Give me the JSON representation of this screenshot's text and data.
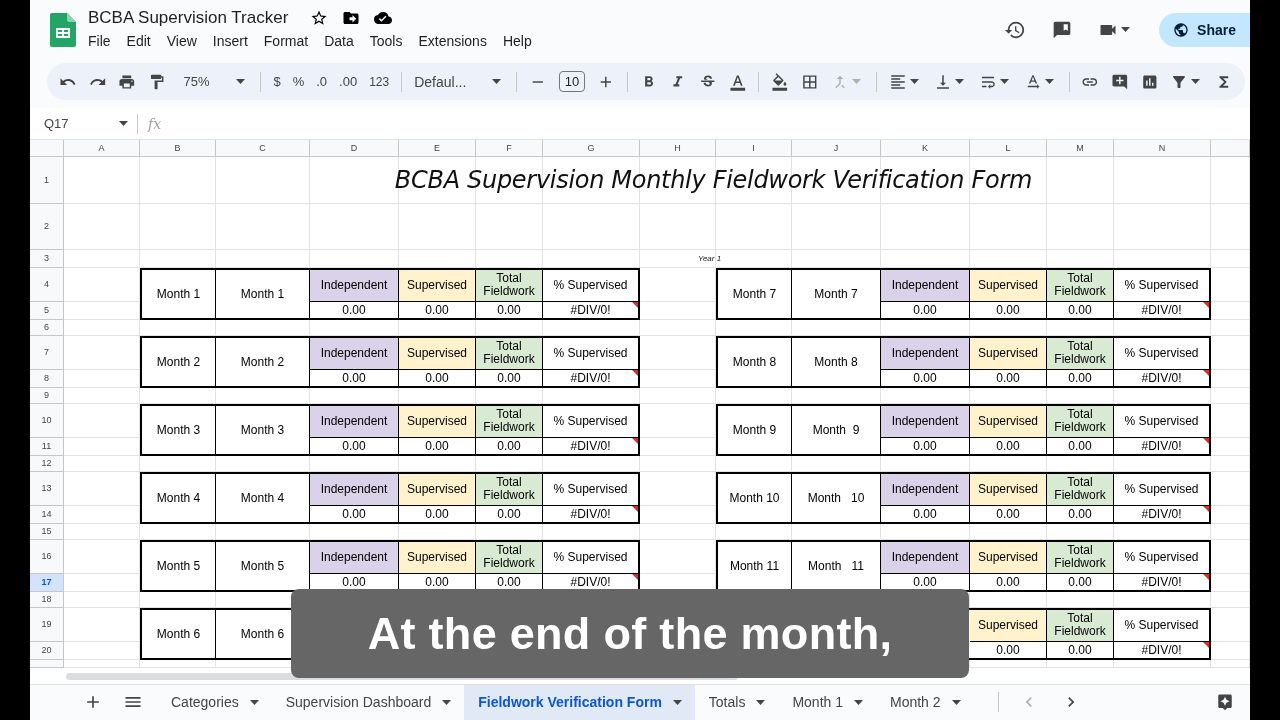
{
  "document": {
    "title": "BCBA Supervision Tracker"
  },
  "menu": [
    "File",
    "Edit",
    "View",
    "Insert",
    "Format",
    "Data",
    "Tools",
    "Extensions",
    "Help"
  ],
  "share": "Share",
  "toolbar": {
    "zoom": "75%",
    "format_items": [
      "$",
      "%",
      ".0",
      ".00",
      "123"
    ],
    "font": "Defaul...",
    "font_size": "10"
  },
  "formula_bar": {
    "cell_ref": "Q17",
    "fx": "fx"
  },
  "columns": [
    "A",
    "B",
    "C",
    "D",
    "E",
    "F",
    "G",
    "H",
    "I",
    "J",
    "K",
    "L",
    "M",
    "N"
  ],
  "rows": [
    {
      "label": "1",
      "selected": false
    },
    {
      "label": "2",
      "selected": false
    },
    {
      "label": "3",
      "selected": false
    },
    {
      "label": "4",
      "selected": false
    },
    {
      "label": "5",
      "selected": false
    },
    {
      "label": "6",
      "selected": false
    },
    {
      "label": "7",
      "selected": false
    },
    {
      "label": "8",
      "selected": false
    },
    {
      "label": "9",
      "selected": false
    },
    {
      "label": "10",
      "selected": false
    },
    {
      "label": "11",
      "selected": false
    },
    {
      "label": "12",
      "selected": false
    },
    {
      "label": "13",
      "selected": false
    },
    {
      "label": "14",
      "selected": false
    },
    {
      "label": "15",
      "selected": false
    },
    {
      "label": "16",
      "selected": false
    },
    {
      "label": "17",
      "selected": true
    },
    {
      "label": "18",
      "selected": false
    },
    {
      "label": "19",
      "selected": false
    },
    {
      "label": "20",
      "selected": false
    }
  ],
  "title": "BCBA Supervision Monthly Fieldwork Verification Form",
  "year_label": "Year 1",
  "left_blocks": [
    {
      "month": "Month 1",
      "month_2": "Month 1",
      "headers": [
        {
          "label": "Independent",
          "color": "#d9d2e9"
        },
        {
          "label": "Supervised",
          "color": "#fff2cc"
        },
        {
          "label": "Total Fieldwork",
          "color": "#d9ead3"
        },
        {
          "label": "% Supervised",
          "color": "#ffffff"
        }
      ],
      "values": [
        "0.00",
        "0.00",
        "0.00",
        "#DIV/0!"
      ]
    },
    {
      "month": "Month 2",
      "month_2": "Month 2",
      "headers": [
        {
          "label": "Independent",
          "color": "#d9d2e9"
        },
        {
          "label": "Supervised",
          "color": "#fff2cc"
        },
        {
          "label": "Total Fieldwork",
          "color": "#d9ead3"
        },
        {
          "label": "% Supervised",
          "color": "#ffffff"
        }
      ],
      "values": [
        "0.00",
        "0.00",
        "0.00",
        "#DIV/0!"
      ]
    },
    {
      "month": "Month 3",
      "month_2": "Month 3",
      "headers": [
        {
          "label": "Independent",
          "color": "#d9d2e9"
        },
        {
          "label": "Supervised",
          "color": "#fff2cc"
        },
        {
          "label": "Total Fieldwork",
          "color": "#d9ead3"
        },
        {
          "label": "% Supervised",
          "color": "#ffffff"
        }
      ],
      "values": [
        "0.00",
        "0.00",
        "0.00",
        "#DIV/0!"
      ]
    },
    {
      "month": "Month 4",
      "month_2": "Month 4",
      "headers": [
        {
          "label": "Independent",
          "color": "#d9d2e9"
        },
        {
          "label": "Supervised",
          "color": "#fff2cc"
        },
        {
          "label": "Total Fieldwork",
          "color": "#d9ead3"
        },
        {
          "label": "% Supervised",
          "color": "#ffffff"
        }
      ],
      "values": [
        "0.00",
        "0.00",
        "0.00",
        "#DIV/0!"
      ]
    },
    {
      "month": "Month 5",
      "month_2": "Month 5",
      "headers": [
        {
          "label": "Independent",
          "color": "#d9d2e9"
        },
        {
          "label": "Supervised",
          "color": "#fff2cc"
        },
        {
          "label": "Total Fieldwork",
          "color": "#d9ead3"
        },
        {
          "label": "% Supervised",
          "color": "#ffffff"
        }
      ],
      "values": [
        "0.00",
        "0.00",
        "0.00",
        "#DIV/0!"
      ]
    },
    {
      "month": "Month 6",
      "month_2": "Month 6"
    }
  ],
  "right_blocks": [
    {
      "month": "Month 7",
      "month_2": "Month 7",
      "headers": [
        {
          "label": "Independent",
          "color": "#d9d2e9"
        },
        {
          "label": "Supervised",
          "color": "#fff2cc"
        },
        {
          "label": "Total Fieldwork",
          "color": "#d9ead3"
        },
        {
          "label": "% Supervised",
          "color": "#ffffff"
        }
      ],
      "values": [
        "0.00",
        "0.00",
        "0.00",
        "#DIV/0!"
      ]
    },
    {
      "month": "Month 8",
      "month_2": "Month 8",
      "headers": [
        {
          "label": "Independent",
          "color": "#d9d2e9"
        },
        {
          "label": "Supervised",
          "color": "#fff2cc"
        },
        {
          "label": "Total Fieldwork",
          "color": "#d9ead3"
        },
        {
          "label": "% Supervised",
          "color": "#ffffff"
        }
      ],
      "values": [
        "0.00",
        "0.00",
        "0.00",
        "#DIV/0!"
      ]
    },
    {
      "month": "Month 9",
      "month_2": "Month  9",
      "headers": [
        {
          "label": "Independent",
          "color": "#d9d2e9"
        },
        {
          "label": "Supervised",
          "color": "#fff2cc"
        },
        {
          "label": "Total Fieldwork",
          "color": "#d9ead3"
        },
        {
          "label": "% Supervised",
          "color": "#ffffff"
        }
      ],
      "values": [
        "0.00",
        "0.00",
        "0.00",
        "#DIV/0!"
      ]
    },
    {
      "month": "Month 10",
      "month_2": "Month   10",
      "headers": [
        {
          "label": "Independent",
          "color": "#d9d2e9"
        },
        {
          "label": "Supervised",
          "color": "#fff2cc"
        },
        {
          "label": "Total Fieldwork",
          "color": "#d9ead3"
        },
        {
          "label": "% Supervised",
          "color": "#ffffff"
        }
      ],
      "values": [
        "0.00",
        "0.00",
        "0.00",
        "#DIV/0!"
      ]
    },
    {
      "month": "Month 11",
      "month_2": "Month   11",
      "headers": [
        {
          "label": "Independent",
          "color": "#d9d2e9"
        },
        {
          "label": "Supervised",
          "color": "#fff2cc"
        },
        {
          "label": "Total Fieldwork",
          "color": "#d9ead3"
        },
        {
          "label": "% Supervised",
          "color": "#ffffff"
        }
      ],
      "values": [
        "0.00",
        "0.00",
        "0.00",
        "#DIV/0!"
      ]
    },
    {
      "headers": [
        {
          "label": "Supervised",
          "color": "#fff2cc"
        },
        {
          "label": "Total Fieldwork",
          "color": "#d9ead3"
        },
        {
          "label": "% Supervised",
          "color": "#ffffff"
        }
      ],
      "values": [
        "0.00",
        "0.00",
        "#DIV/0!"
      ]
    }
  ],
  "sheet_tabs": [
    {
      "label": "Categories",
      "selected": false
    },
    {
      "label": "Supervision Dashboard",
      "selected": false
    },
    {
      "label": "Fieldwork Verification Form",
      "selected": true
    },
    {
      "label": "Totals",
      "selected": false
    },
    {
      "label": "Month 1",
      "selected": false
    },
    {
      "label": "Month 2",
      "selected": false
    }
  ],
  "caption": "At the end of the month,"
}
